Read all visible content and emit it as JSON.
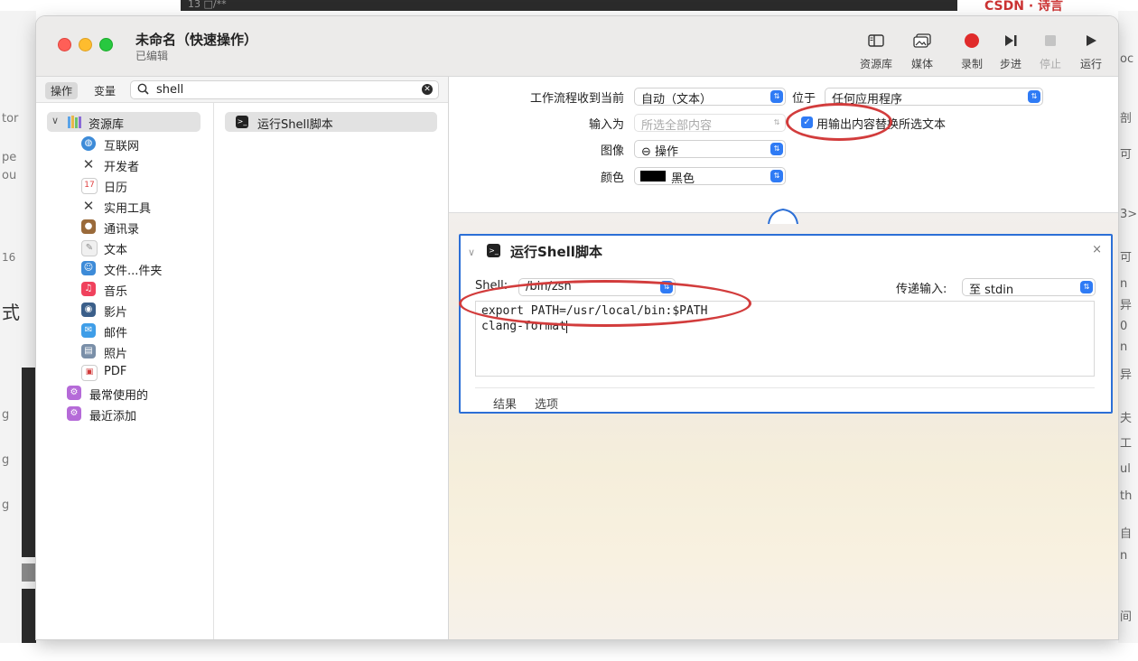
{
  "background": {
    "top_fragment": "13 □/**",
    "right_fragment": "CSDN · 诗言",
    "left_fragments": [
      "tor",
      "pe",
      "ou",
      "16",
      "式",
      "g",
      "g",
      "g"
    ],
    "right_edge_fragments": [
      "oc",
      "剖",
      "可",
      "3>",
      "可",
      "n",
      "异",
      "0",
      "n",
      "异",
      "夫",
      "工",
      "ul",
      "th",
      "自",
      "n",
      "间"
    ]
  },
  "window": {
    "title": "未命名（快速操作）",
    "subtitle": "已编辑"
  },
  "toolbar": {
    "library": "资源库",
    "media": "媒体",
    "record": "录制",
    "step": "步进",
    "stop": "停止",
    "run": "运行"
  },
  "left_pane": {
    "tab_actions": "操作",
    "tab_variables": "变量",
    "search_value": "shell",
    "library_root": "资源库",
    "library_items": [
      {
        "label": "互联网",
        "icon": "globe-icon",
        "color": "#3d8bd8"
      },
      {
        "label": "开发者",
        "icon": "tools-icon",
        "color": "#555555"
      },
      {
        "label": "日历",
        "icon": "calendar-icon",
        "color": "#e04040"
      },
      {
        "label": "实用工具",
        "icon": "utilities-icon",
        "color": "#555555"
      },
      {
        "label": "通讯录",
        "icon": "contacts-icon",
        "color": "#9a6a3a"
      },
      {
        "label": "文本",
        "icon": "text-icon",
        "color": "#bbbbbb"
      },
      {
        "label": "文件...件夹",
        "icon": "finder-icon",
        "color": "#3d8bd8"
      },
      {
        "label": "音乐",
        "icon": "music-icon",
        "color": "#f0425d"
      },
      {
        "label": "影片",
        "icon": "movie-icon",
        "color": "#3b5f8a"
      },
      {
        "label": "邮件",
        "icon": "mail-icon",
        "color": "#3f9ee8"
      },
      {
        "label": "照片",
        "icon": "photos-icon",
        "color": "#7a8fa8"
      },
      {
        "label": "PDF",
        "icon": "pdf-icon",
        "color": "#d23a3a"
      }
    ],
    "smart_groups": [
      {
        "label": "最常使用的",
        "icon": "smart-folder-icon",
        "color": "#b56ad8"
      },
      {
        "label": "最近添加",
        "icon": "smart-folder-icon",
        "color": "#b56ad8"
      }
    ],
    "result": "运行Shell脚本"
  },
  "workflow": {
    "receives_label": "工作流程收到当前",
    "receives_value": "自动（文本）",
    "in_label": "位于",
    "in_value": "任何应用程序",
    "input_label": "输入为",
    "input_value": "所选全部内容",
    "replace_checkbox_label": "用输出内容替换所选文本",
    "image_label": "图像",
    "image_value": "⊖ 操作",
    "color_label": "颜色",
    "color_value": "黑色"
  },
  "action": {
    "title": "运行Shell脚本",
    "shell_label": "Shell:",
    "shell_value": "/bin/zsh",
    "pass_input_label": "传递输入:",
    "pass_input_value": "至 stdin",
    "code_line1": "export PATH=/usr/local/bin:$PATH",
    "code_line2": "clang-format",
    "tab_results": "结果",
    "tab_options": "选项",
    "close": "×"
  },
  "colors": {
    "accent": "#2f7bf5",
    "annotation": "#d23c3c",
    "selection_border": "#2c6fd6"
  }
}
